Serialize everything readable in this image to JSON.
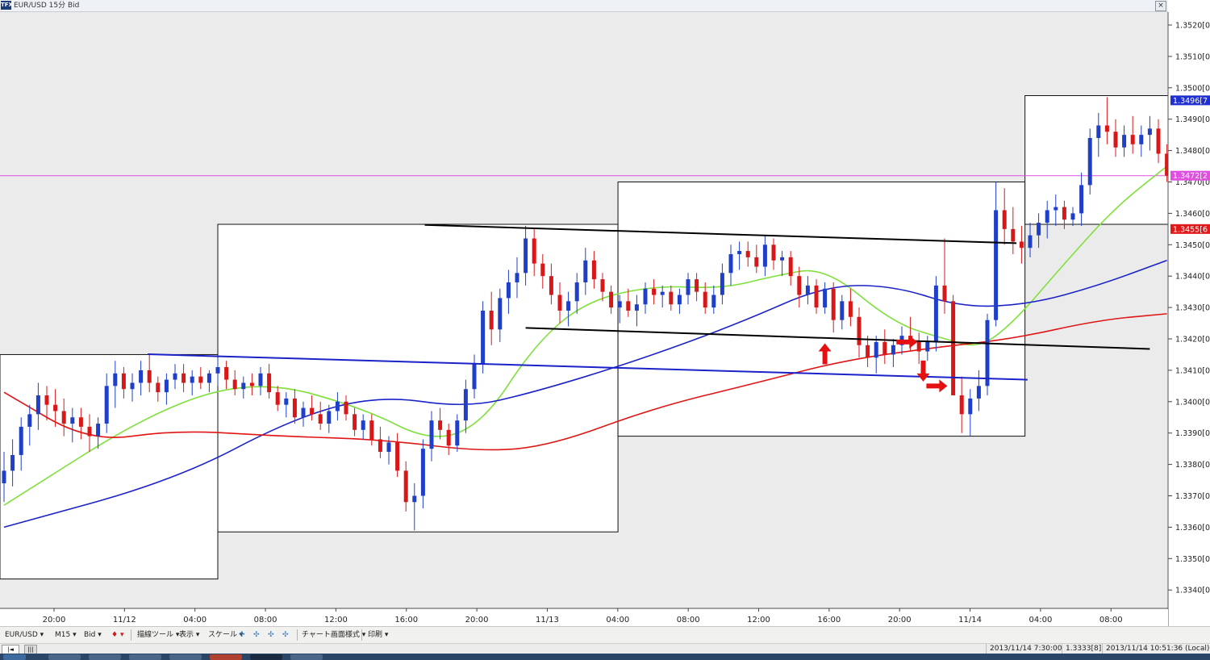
{
  "window": {
    "title": "EUR/USD 15分 Bid",
    "icon_text": "TFX"
  },
  "toolbar": {
    "symbol": "EUR/USD",
    "timeframe": "M15",
    "price_type": "Bid",
    "draw_tools": "描線ツール",
    "display": "表示",
    "scale": "スケール",
    "chart_style": "チャート画面様式",
    "print": "印刷"
  },
  "status": {
    "cursor_time": "2013/11/14 7:30:00",
    "cursor_price": "1.3333[8]",
    "clock": "2013/11/14 10:51:36 (Local)"
  },
  "colors": {
    "candle_up": "#1f3fc8",
    "candle_down": "#d81818",
    "ma_short": "#7ee03a",
    "ma_mid": "#1a22c8",
    "ma_long": "#e01515",
    "current_line": "#e050e0"
  },
  "chart_data": {
    "type": "candlestick",
    "instrument": "EUR/USD",
    "timeframe": "15分",
    "price_axis_labels": [
      "1.3520[0]",
      "1.3510[0]",
      "1.3500[0]",
      "1.3490[0]",
      "1.3480[0]",
      "1.3470[0]",
      "1.3460[0]",
      "1.3450[0]",
      "1.3440[0]",
      "1.3430[0]",
      "1.3420[0]",
      "1.3410[0]",
      "1.3400[0]",
      "1.3390[0]",
      "1.3380[0]",
      "1.3370[0]",
      "1.3360[0]",
      "1.3350[0]",
      "1.3340[0]"
    ],
    "ylim": [
      1.3335,
      1.3525
    ],
    "time_axis_labels": [
      "20:00",
      "11/12",
      "04:00",
      "08:00",
      "12:00",
      "16:00",
      "20:00",
      "11/13",
      "04:00",
      "08:00",
      "12:00",
      "16:00",
      "20:00",
      "11/14",
      "04:00",
      "08:00"
    ],
    "price_tags": [
      {
        "text": "1.3496[7",
        "value": 1.3496,
        "color": "#2030d0"
      },
      {
        "text": "1.3472[2",
        "value": 1.3472,
        "color": "#e050e0"
      },
      {
        "text": "1.3455[6",
        "value": 1.3455,
        "color": "#e01a1a"
      }
    ],
    "current_price": 1.3472,
    "candles": [
      [
        1.3374,
        1.3384,
        1.3368,
        1.3378
      ],
      [
        1.3378,
        1.3388,
        1.3373,
        1.3383
      ],
      [
        1.3383,
        1.3395,
        1.3378,
        1.3392
      ],
      [
        1.3392,
        1.3399,
        1.3386,
        1.3396
      ],
      [
        1.3396,
        1.3406,
        1.3391,
        1.3402
      ],
      [
        1.3402,
        1.3405,
        1.3394,
        1.3399
      ],
      [
        1.3399,
        1.3404,
        1.3392,
        1.3397
      ],
      [
        1.3397,
        1.3401,
        1.3389,
        1.3393
      ],
      [
        1.3393,
        1.3398,
        1.3387,
        1.3395
      ],
      [
        1.3395,
        1.3398,
        1.3388,
        1.3392
      ],
      [
        1.3392,
        1.3396,
        1.3384,
        1.3389
      ],
      [
        1.3389,
        1.3395,
        1.3385,
        1.3393
      ],
      [
        1.3393,
        1.3409,
        1.339,
        1.3405
      ],
      [
        1.3405,
        1.3413,
        1.3398,
        1.3409
      ],
      [
        1.3409,
        1.3411,
        1.3401,
        1.3404
      ],
      [
        1.3404,
        1.3409,
        1.34,
        1.3406
      ],
      [
        1.3406,
        1.3413,
        1.3402,
        1.341
      ],
      [
        1.341,
        1.3415,
        1.3403,
        1.3406
      ],
      [
        1.3406,
        1.3408,
        1.34,
        1.3403
      ],
      [
        1.3403,
        1.3409,
        1.3399,
        1.3407
      ],
      [
        1.3407,
        1.3412,
        1.3404,
        1.3409
      ],
      [
        1.3409,
        1.3412,
        1.3403,
        1.3406
      ],
      [
        1.3406,
        1.341,
        1.3402,
        1.3408
      ],
      [
        1.3408,
        1.3411,
        1.3404,
        1.3406
      ],
      [
        1.3406,
        1.341,
        1.3403,
        1.3409
      ],
      [
        1.3409,
        1.3414,
        1.3405,
        1.3411
      ],
      [
        1.3411,
        1.3413,
        1.3404,
        1.3407
      ],
      [
        1.3407,
        1.341,
        1.3402,
        1.3404
      ],
      [
        1.3404,
        1.3408,
        1.3401,
        1.3406
      ],
      [
        1.3406,
        1.3409,
        1.3402,
        1.3405
      ],
      [
        1.3405,
        1.3411,
        1.3402,
        1.3409
      ],
      [
        1.3409,
        1.3412,
        1.3401,
        1.3403
      ],
      [
        1.3403,
        1.3405,
        1.3397,
        1.3399
      ],
      [
        1.3399,
        1.3403,
        1.3395,
        1.3401
      ],
      [
        1.3401,
        1.3404,
        1.3393,
        1.3395
      ],
      [
        1.3395,
        1.34,
        1.3392,
        1.3398
      ],
      [
        1.3398,
        1.3402,
        1.3394,
        1.3396
      ],
      [
        1.3396,
        1.34,
        1.3391,
        1.3393
      ],
      [
        1.3393,
        1.3399,
        1.339,
        1.3397
      ],
      [
        1.3397,
        1.3403,
        1.3394,
        1.34
      ],
      [
        1.34,
        1.3402,
        1.3394,
        1.3396
      ],
      [
        1.3396,
        1.3398,
        1.3389,
        1.3391
      ],
      [
        1.3391,
        1.3396,
        1.3388,
        1.3394
      ],
      [
        1.3394,
        1.3396,
        1.3386,
        1.3388
      ],
      [
        1.3388,
        1.3392,
        1.3382,
        1.3384
      ],
      [
        1.3384,
        1.3389,
        1.338,
        1.3387
      ],
      [
        1.3387,
        1.339,
        1.3376,
        1.3378
      ],
      [
        1.3378,
        1.3381,
        1.3365,
        1.3368
      ],
      [
        1.3368,
        1.3374,
        1.3359,
        1.337
      ],
      [
        1.337,
        1.3388,
        1.3366,
        1.3385
      ],
      [
        1.3385,
        1.3397,
        1.3381,
        1.3394
      ],
      [
        1.3394,
        1.3398,
        1.3388,
        1.3391
      ],
      [
        1.3391,
        1.3393,
        1.3383,
        1.3386
      ],
      [
        1.3386,
        1.3396,
        1.3384,
        1.3394
      ],
      [
        1.3394,
        1.3407,
        1.339,
        1.3404
      ],
      [
        1.3404,
        1.3415,
        1.3401,
        1.3412
      ],
      [
        1.3412,
        1.3432,
        1.3409,
        1.3429
      ],
      [
        1.3429,
        1.3435,
        1.3418,
        1.3423
      ],
      [
        1.3423,
        1.3436,
        1.3419,
        1.3433
      ],
      [
        1.3433,
        1.3442,
        1.3428,
        1.3438
      ],
      [
        1.3438,
        1.3446,
        1.3433,
        1.3441
      ],
      [
        1.3441,
        1.3456,
        1.3437,
        1.3452
      ],
      [
        1.3452,
        1.3455,
        1.344,
        1.3444
      ],
      [
        1.3444,
        1.3447,
        1.3436,
        1.344
      ],
      [
        1.344,
        1.3444,
        1.3431,
        1.3434
      ],
      [
        1.3434,
        1.3438,
        1.3425,
        1.3429
      ],
      [
        1.3429,
        1.3435,
        1.3424,
        1.3432
      ],
      [
        1.3432,
        1.3441,
        1.3428,
        1.3438
      ],
      [
        1.3438,
        1.3449,
        1.3434,
        1.3445
      ],
      [
        1.3445,
        1.3448,
        1.3436,
        1.3439
      ],
      [
        1.3439,
        1.3441,
        1.3432,
        1.3435
      ],
      [
        1.3435,
        1.3437,
        1.3428,
        1.343
      ],
      [
        1.343,
        1.3434,
        1.3425,
        1.3432
      ],
      [
        1.3432,
        1.3436,
        1.3427,
        1.3429
      ],
      [
        1.3429,
        1.3434,
        1.3424,
        1.3431
      ],
      [
        1.3431,
        1.3438,
        1.3428,
        1.3436
      ],
      [
        1.3436,
        1.3439,
        1.3431,
        1.3434
      ],
      [
        1.3434,
        1.3437,
        1.343,
        1.3435
      ],
      [
        1.3435,
        1.3437,
        1.3429,
        1.3431
      ],
      [
        1.3431,
        1.3436,
        1.3428,
        1.3434
      ],
      [
        1.3434,
        1.3441,
        1.3431,
        1.3439
      ],
      [
        1.3439,
        1.3441,
        1.3432,
        1.3435
      ],
      [
        1.3435,
        1.3438,
        1.3428,
        1.343
      ],
      [
        1.343,
        1.3437,
        1.3428,
        1.3434
      ],
      [
        1.3434,
        1.3444,
        1.3431,
        1.3441
      ],
      [
        1.3441,
        1.345,
        1.3437,
        1.3447
      ],
      [
        1.3447,
        1.3451,
        1.3442,
        1.3448
      ],
      [
        1.3448,
        1.3451,
        1.3443,
        1.3446
      ],
      [
        1.3446,
        1.345,
        1.3441,
        1.3443
      ],
      [
        1.3443,
        1.3453,
        1.344,
        1.345
      ],
      [
        1.345,
        1.3452,
        1.3442,
        1.3445
      ],
      [
        1.3445,
        1.3448,
        1.344,
        1.3446
      ],
      [
        1.3446,
        1.3448,
        1.3437,
        1.344
      ],
      [
        1.344,
        1.3443,
        1.343,
        1.3434
      ],
      [
        1.3434,
        1.344,
        1.3431,
        1.3437
      ],
      [
        1.3437,
        1.3439,
        1.3428,
        1.343
      ],
      [
        1.343,
        1.3438,
        1.3428,
        1.3436
      ],
      [
        1.3436,
        1.3438,
        1.3422,
        1.3426
      ],
      [
        1.3426,
        1.3434,
        1.3423,
        1.3432
      ],
      [
        1.3432,
        1.3436,
        1.3424,
        1.3427
      ],
      [
        1.3427,
        1.343,
        1.3414,
        1.3418
      ],
      [
        1.3418,
        1.3421,
        1.3411,
        1.3414
      ],
      [
        1.3414,
        1.3421,
        1.3409,
        1.3419
      ],
      [
        1.3419,
        1.3423,
        1.3412,
        1.3415
      ],
      [
        1.3415,
        1.342,
        1.3411,
        1.3418
      ],
      [
        1.3418,
        1.3424,
        1.3415,
        1.3421
      ],
      [
        1.3421,
        1.3427,
        1.3416,
        1.3419
      ],
      [
        1.3419,
        1.3422,
        1.3412,
        1.3416
      ],
      [
        1.3416,
        1.3421,
        1.3413,
        1.3419
      ],
      [
        1.3419,
        1.344,
        1.3416,
        1.3437
      ],
      [
        1.3437,
        1.3452,
        1.3428,
        1.3432
      ],
      [
        1.3432,
        1.3434,
        1.3404,
        1.3402
      ],
      [
        1.3402,
        1.3408,
        1.339,
        1.3396
      ],
      [
        1.3396,
        1.3404,
        1.3389,
        1.3401
      ],
      [
        1.3401,
        1.341,
        1.3397,
        1.3405
      ],
      [
        1.3405,
        1.3428,
        1.3402,
        1.3426
      ],
      [
        1.3426,
        1.347,
        1.3424,
        1.3461
      ],
      [
        1.3461,
        1.3468,
        1.345,
        1.3455
      ],
      [
        1.3455,
        1.3462,
        1.3447,
        1.3451
      ],
      [
        1.3451,
        1.3456,
        1.3444,
        1.3449
      ],
      [
        1.3449,
        1.3457,
        1.3446,
        1.3453
      ],
      [
        1.3453,
        1.346,
        1.3449,
        1.3457
      ],
      [
        1.3457,
        1.3464,
        1.3452,
        1.3461
      ],
      [
        1.3461,
        1.3466,
        1.3456,
        1.3462
      ],
      [
        1.3462,
        1.3464,
        1.3455,
        1.3458
      ],
      [
        1.3458,
        1.3462,
        1.3456,
        1.346
      ],
      [
        1.346,
        1.3473,
        1.3456,
        1.3469
      ],
      [
        1.3469,
        1.3487,
        1.3466,
        1.3484
      ],
      [
        1.3484,
        1.3492,
        1.3478,
        1.3488
      ],
      [
        1.3488,
        1.3497,
        1.3482,
        1.3486
      ],
      [
        1.3486,
        1.349,
        1.3478,
        1.3481
      ],
      [
        1.3481,
        1.3488,
        1.3478,
        1.3485
      ],
      [
        1.3485,
        1.3491,
        1.3479,
        1.3482
      ],
      [
        1.3482,
        1.3488,
        1.3478,
        1.3485
      ],
      [
        1.3485,
        1.3491,
        1.348,
        1.3487
      ],
      [
        1.3487,
        1.349,
        1.3476,
        1.3479
      ],
      [
        1.3479,
        1.3482,
        1.347,
        1.3472
      ]
    ],
    "moving_averages": [
      {
        "color": "#7ee03a",
        "points": [
          [
            0,
            1.3367
          ],
          [
            18,
            1.3398
          ],
          [
            30,
            1.3407
          ],
          [
            42,
            1.3398
          ],
          [
            50,
            1.3387
          ],
          [
            56,
            1.3393
          ],
          [
            62,
            1.3418
          ],
          [
            68,
            1.3432
          ],
          [
            76,
            1.3437
          ],
          [
            84,
            1.3436
          ],
          [
            90,
            1.344
          ],
          [
            96,
            1.3443
          ],
          [
            104,
            1.3425
          ],
          [
            110,
            1.342
          ],
          [
            114,
            1.3417
          ],
          [
            118,
            1.3425
          ],
          [
            124,
            1.3444
          ],
          [
            130,
            1.3462
          ],
          [
            136,
            1.3475
          ]
        ]
      },
      {
        "color": "#1a22c8",
        "points": [
          [
            0,
            1.336
          ],
          [
            20,
            1.3375
          ],
          [
            34,
            1.3395
          ],
          [
            44,
            1.3402
          ],
          [
            54,
            1.3398
          ],
          [
            62,
            1.3403
          ],
          [
            74,
            1.3413
          ],
          [
            86,
            1.3425
          ],
          [
            96,
            1.3437
          ],
          [
            104,
            1.3437
          ],
          [
            112,
            1.343
          ],
          [
            120,
            1.3431
          ],
          [
            128,
            1.3437
          ],
          [
            136,
            1.3445
          ]
        ]
      },
      {
        "color": "#e01515",
        "points": [
          [
            0,
            1.3403
          ],
          [
            10,
            1.3387
          ],
          [
            20,
            1.3391
          ],
          [
            32,
            1.3389
          ],
          [
            44,
            1.3388
          ],
          [
            56,
            1.3384
          ],
          [
            64,
            1.3386
          ],
          [
            76,
            1.3398
          ],
          [
            88,
            1.3406
          ],
          [
            98,
            1.3413
          ],
          [
            108,
            1.3417
          ],
          [
            118,
            1.342
          ],
          [
            128,
            1.3426
          ],
          [
            136,
            1.3428
          ]
        ]
      }
    ],
    "trendlines": [
      {
        "color": "#000000",
        "from": [
          49.2,
          1.34563
        ],
        "to": [
          118.4,
          1.34505
        ]
      },
      {
        "color": "#000000",
        "from": [
          61,
          1.34235
        ],
        "to": [
          134,
          1.34168
        ]
      },
      {
        "color": "#1a22c8",
        "from": [
          16.8,
          1.34151
        ],
        "to": [
          119.7,
          1.3407
        ]
      }
    ],
    "range_boxes": [
      {
        "from": [
          -1,
          1.3415
        ],
        "to": [
          25,
          1.33435
        ]
      },
      {
        "from": [
          25,
          1.34565
        ],
        "to": [
          71.8,
          1.33585
        ]
      },
      {
        "from": [
          71.8,
          1.347
        ],
        "to": [
          119.4,
          1.3389
        ]
      },
      {
        "from": [
          119.4,
          1.34975
        ],
        "to": [
          137,
          1.34565
        ]
      }
    ],
    "signal_arrows": [
      {
        "dir": "up",
        "at": [
          96,
          1.3415
        ]
      },
      {
        "dir": "right",
        "at": [
          105.5,
          1.3419
        ]
      },
      {
        "dir": "down",
        "at": [
          107.5,
          1.341
        ]
      },
      {
        "dir": "right",
        "at": [
          109,
          1.3405
        ]
      }
    ],
    "xlim": [
      -0.5,
      130
    ]
  }
}
